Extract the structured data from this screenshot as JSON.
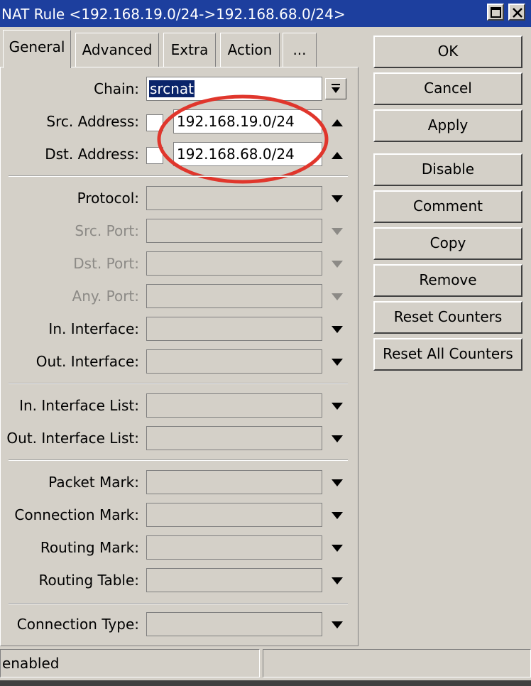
{
  "window": {
    "title": "NAT Rule <192.168.19.0/24->192.168.68.0/24>"
  },
  "tabs": [
    {
      "label": "General"
    },
    {
      "label": "Advanced"
    },
    {
      "label": "Extra"
    },
    {
      "label": "Action"
    },
    {
      "label": "..."
    }
  ],
  "general": {
    "chain": {
      "label": "Chain:",
      "value": "srcnat"
    },
    "src_address": {
      "label": "Src. Address:",
      "value": "192.168.19.0/24"
    },
    "dst_address": {
      "label": "Dst. Address:",
      "value": "192.168.68.0/24"
    },
    "protocol": {
      "label": "Protocol:"
    },
    "src_port": {
      "label": "Src. Port:"
    },
    "dst_port": {
      "label": "Dst. Port:"
    },
    "any_port": {
      "label": "Any. Port:"
    },
    "in_interface": {
      "label": "In. Interface:"
    },
    "out_interface": {
      "label": "Out. Interface:"
    },
    "in_interface_list": {
      "label": "In. Interface List:"
    },
    "out_interface_list": {
      "label": "Out. Interface List:"
    },
    "packet_mark": {
      "label": "Packet Mark:"
    },
    "connection_mark": {
      "label": "Connection Mark:"
    },
    "routing_mark": {
      "label": "Routing Mark:"
    },
    "routing_table": {
      "label": "Routing Table:"
    },
    "connection_type": {
      "label": "Connection Type:"
    }
  },
  "buttons": {
    "ok": "OK",
    "cancel": "Cancel",
    "apply": "Apply",
    "disable": "Disable",
    "comment": "Comment",
    "copy": "Copy",
    "remove": "Remove",
    "reset_counters": "Reset Counters",
    "reset_all_counters": "Reset All Counters"
  },
  "status": {
    "left": "enabled",
    "right": ""
  },
  "colors": {
    "title_bar": "#1d3f9e",
    "highlight": "#0a246a",
    "annotation_circle": "#e0362c"
  }
}
